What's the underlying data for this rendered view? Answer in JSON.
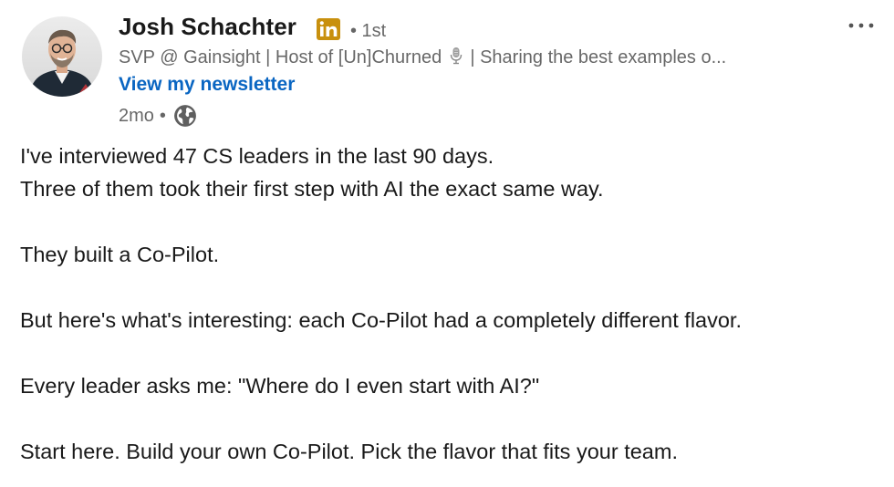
{
  "post": {
    "author": {
      "name": "Josh Schachter",
      "badge_icon": "linkedin-badge-icon",
      "badge_color": "#c8900e",
      "degree": "• 1st",
      "headline_before": "SVP @ Gainsight | Host of [Un]Churned",
      "headline_icon": "microphone-icon",
      "headline_after": "| Sharing the best examples o...",
      "newsletter_link": "View my newsletter",
      "time": "2mo",
      "time_separator": "•",
      "visibility_icon": "globe-icon"
    },
    "menu_icon": "ellipsis-icon",
    "body_lines": [
      "I've interviewed 47 CS leaders in the last 90 days.",
      "Three of them took their first step with AI the exact same way.",
      "",
      "They built a Co-Pilot.",
      "",
      "But here's what's interesting: each Co-Pilot had a completely different flavor.",
      "",
      "Every leader asks me: \"Where do I even start with AI?\"",
      "",
      "Start here. Build your own Co-Pilot. Pick the flavor that fits your team."
    ],
    "colors": {
      "link": "#0a66c2",
      "secondary_text": "#666666",
      "primary_text": "#1a1a1a"
    }
  }
}
